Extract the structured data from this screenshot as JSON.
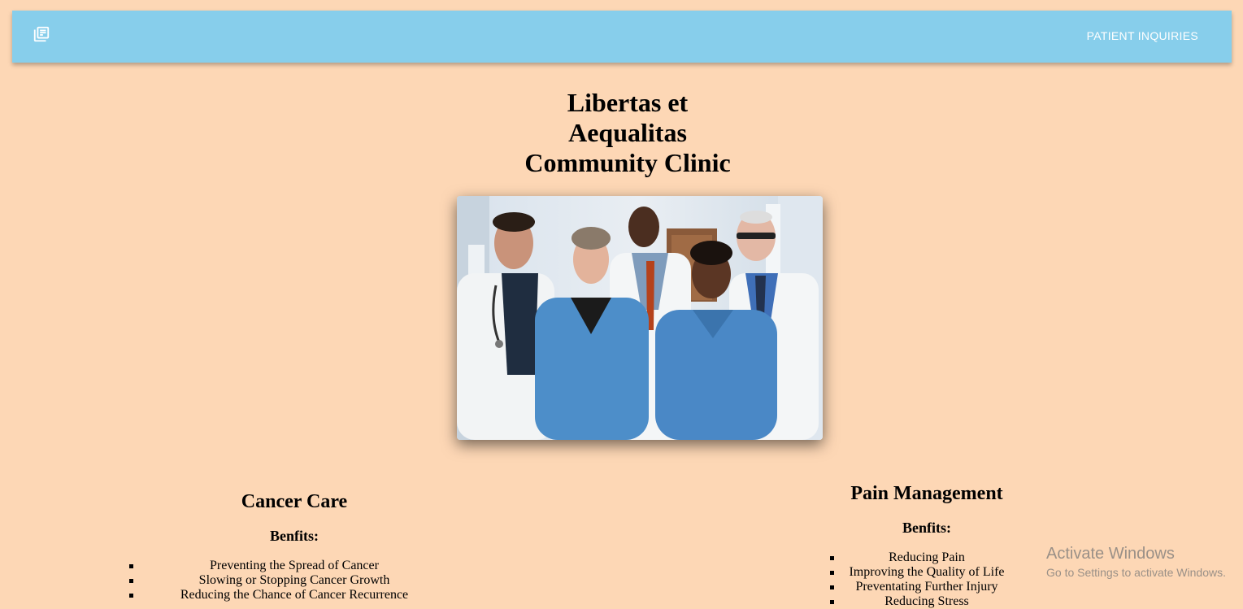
{
  "navbar": {
    "menu_icon": "library-books-icon",
    "link_label": "PATIENT INQUIRIES",
    "background": "#87ceeb"
  },
  "page": {
    "background": "#fdd7b5",
    "title_lines": [
      "Libertas et",
      "Aequalitas",
      "Community Clinic"
    ]
  },
  "hero_image": {
    "description": "Group of five clinic staff in scrubs and white coats"
  },
  "services": [
    {
      "heading": "Cancer Care",
      "subheading": "Benfits:",
      "items": [
        "Preventing the Spread of Cancer",
        "Slowing or Stopping Cancer Growth",
        "Reducing the Chance of Cancer Recurrence"
      ]
    },
    {
      "heading": "Pain Management",
      "subheading": "Benfits:",
      "items": [
        "Reducing Pain",
        "Improving the Quality of Life",
        "Preventating Further Injury",
        "Reducing Stress"
      ]
    }
  ],
  "os_watermark": {
    "line1": "Activate Windows",
    "line2": "Go to Settings to activate Windows."
  }
}
